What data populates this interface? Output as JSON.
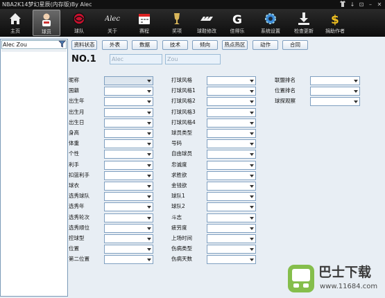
{
  "window": {
    "title": "NBA2K14梦幻星辰(内存版)By Alec",
    "controls": [
      "↓",
      "⊡",
      "–",
      "□",
      "✕"
    ]
  },
  "toolbar": [
    {
      "label": "主页",
      "icon": "home-icon"
    },
    {
      "label": "球员",
      "icon": "player-icon"
    },
    {
      "label": "球队",
      "icon": "team-logo-icon"
    },
    {
      "label": "关于",
      "icon": "alec-signature-icon"
    },
    {
      "label": "赛程",
      "icon": "calendar-icon"
    },
    {
      "label": "奖项",
      "icon": "trophy-icon"
    },
    {
      "label": "球鞋修改",
      "icon": "shoe-brand-icon"
    },
    {
      "label": "佳得乐",
      "icon": "gatorade-icon"
    },
    {
      "label": "系统设置",
      "icon": "gear-icon"
    },
    {
      "label": "检查更新",
      "icon": "download-icon"
    },
    {
      "label": "捐助作者",
      "icon": "dollar-icon"
    }
  ],
  "left_panel": {
    "search_value": "Alec Zou"
  },
  "tabs": [
    "资料状态",
    "外表",
    "数据",
    "技术",
    "倾向",
    "热点热区",
    "动作",
    "合同"
  ],
  "player": {
    "number": "NO.1",
    "first_name": "Alec",
    "last_name": "Zou"
  },
  "form": {
    "col1": [
      "昵称",
      "国籍",
      "出生年",
      "出生月",
      "出生日",
      "身高",
      "体重",
      "个性",
      "利手",
      "扣篮利手",
      "球衣",
      "选秀球队",
      "选秀年",
      "选秀轮次",
      "选秀顺位",
      "控球型",
      "位置",
      "第二位置"
    ],
    "col2": [
      "打球风格",
      "打球风格1",
      "打球风格2",
      "打球风格3",
      "打球风格4",
      "球员类型",
      "号码",
      "自由球员",
      "忠诚度",
      "求胜欲",
      "金钱欲",
      "球队1",
      "球队2",
      "斗志",
      "疲劳度",
      "上场时间",
      "伤病类型",
      "伤病天数"
    ],
    "col3": [
      "联盟排名",
      "位置排名",
      "球探观察"
    ]
  },
  "watermark": {
    "brand": "巴士下载",
    "url": "www.11684.com"
  }
}
